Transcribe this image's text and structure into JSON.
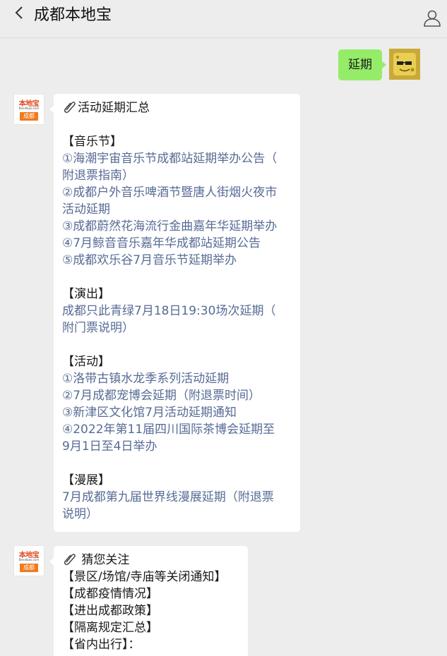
{
  "header": {
    "title": "成都本地宝"
  },
  "outgoing": {
    "text": "延期"
  },
  "bot_avatar": {
    "logo_top": "本地宝",
    "logo_sub": "Bendibao.com",
    "logo_city": "成都"
  },
  "message1": {
    "title": "活动延期汇总",
    "music_heading": "【音乐节】",
    "music_items": [
      "①海潮宇宙音乐节成都站延期举办公告（",
      "附退票指南）",
      "②成都户外音乐啤酒节暨唐人街烟火夜市",
      "活动延期",
      "③成都蔚然花海流行金曲嘉年华延期举办",
      "④7月鲸音音乐嘉年华成都站延期公告",
      "⑤成都欢乐谷7月音乐节延期举办"
    ],
    "show_heading": "【演出】",
    "show_items": [
      "成都只此青绿7月18日19:30场次延期（",
      "附门票说明）"
    ],
    "activity_heading": "【活动】",
    "activity_items": [
      "①洛带古镇水龙季系列活动延期",
      "②7月成都宠博会延期（附退票时间）",
      "③新津区文化馆7月活动延期通知",
      "④2022年第11届四川国际茶博会延期至",
      "9月1日至4日举办"
    ],
    "comic_heading": "【漫展】",
    "comic_items": [
      "7月成都第九届世界线漫展延期（附退票",
      "说明）"
    ]
  },
  "message2": {
    "title": "猜您关注",
    "items": [
      "【景区/场馆/寺庙等关闭通知】",
      "【成都疫情情况】",
      "【进出成都政策】",
      "【隔离规定汇总】",
      "【省内出行】："
    ]
  }
}
